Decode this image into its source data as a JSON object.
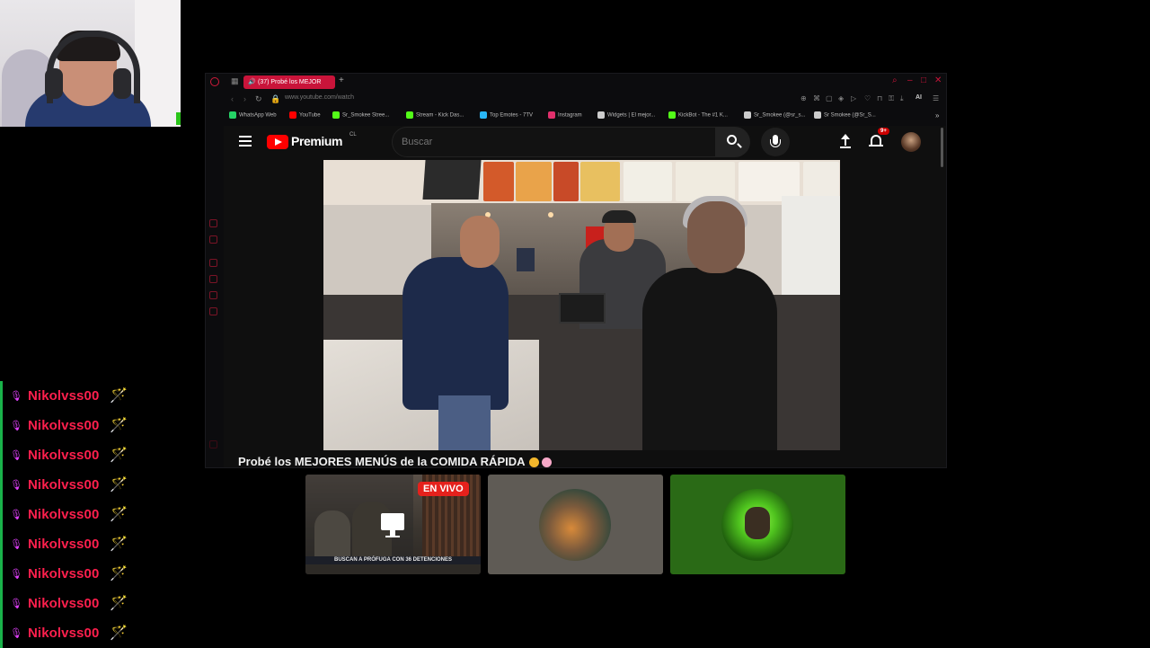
{
  "browser": {
    "tab_title": "(37) Probé los MEJOR",
    "url": "www.youtube.com/watch",
    "bookmarks": [
      {
        "label": "WhatsApp Web",
        "color": "#25d366"
      },
      {
        "label": "YouTube",
        "color": "#ff0000"
      },
      {
        "label": "Sr_Smokee Stree...",
        "color": "#53fc18"
      },
      {
        "label": "Stream - Kick Das...",
        "color": "#53fc18"
      },
      {
        "label": "Top Emotes - 7TV",
        "color": "#29b6f6"
      },
      {
        "label": "Instagram",
        "color": "#e1306c"
      },
      {
        "label": "Widgets | El mejor...",
        "color": "#cccccc"
      },
      {
        "label": "KickBot - The #1 K...",
        "color": "#53fc18"
      },
      {
        "label": "Sr_Smokee (@sr_s...",
        "color": "#cccccc"
      },
      {
        "label": "Sr Smokee (@Sr_S...",
        "color": "#cccccc"
      }
    ],
    "ai_label": "AI"
  },
  "youtube": {
    "logo_text": "Premium",
    "region": "CL",
    "search_placeholder": "Buscar",
    "notification_count": "9+",
    "video_title": "Probé los MEJORES MENÚS de la COMIDA RÁPIDA"
  },
  "chat": {
    "messages": [
      {
        "user": "Nikolvss00"
      },
      {
        "user": "Nikolvss00"
      },
      {
        "user": "Nikolvss00"
      },
      {
        "user": "Nikolvss00"
      },
      {
        "user": "Nikolvss00"
      },
      {
        "user": "Nikolvss00"
      },
      {
        "user": "Nikolvss00"
      },
      {
        "user": "Nikolvss00"
      },
      {
        "user": "Nikolvss00"
      }
    ]
  },
  "cards": {
    "live_badge": "EN VIVO",
    "ticker_text": "BUSCAN A PRÓFUGA CON 36 DETENCIONES"
  },
  "colors": {
    "accent": "#c9143a",
    "chat_name": "#ff1f4d",
    "chat_bar": "#19b24a"
  }
}
